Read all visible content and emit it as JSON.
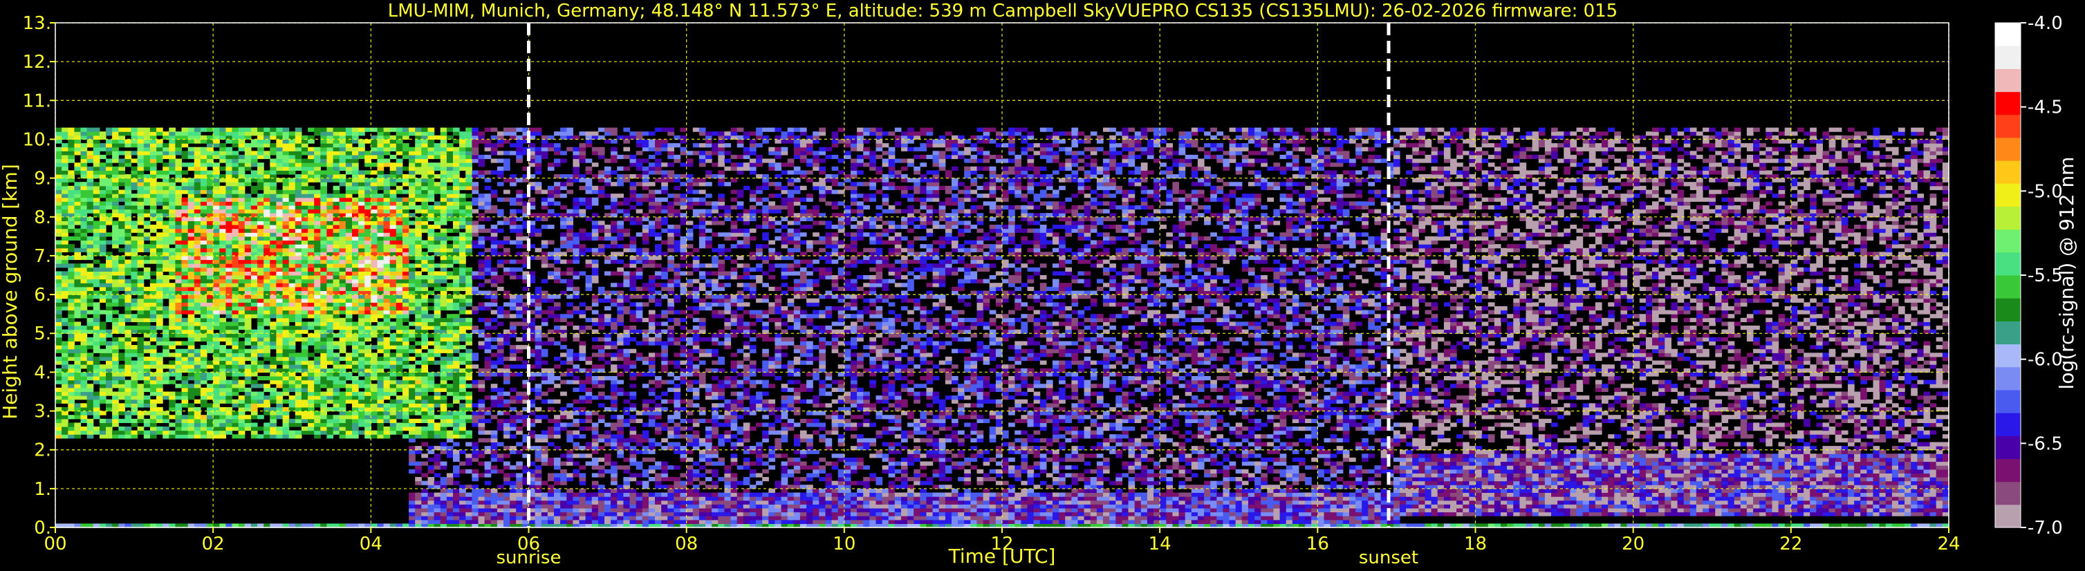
{
  "chart_data": {
    "type": "heatmap",
    "title": "LMU-MIM, Munich, Germany; 48.148° N 11.573° E, altitude: 539 m    Campbell SkyVUEPRO CS135 (CS135LMU): 26-02-2026    firmware: 015",
    "xlabel": "Time [UTC]",
    "ylabel": "Height above ground [km]",
    "xlim": [
      0,
      24
    ],
    "ylim": [
      0,
      13
    ],
    "x_ticks": [
      "00",
      "02",
      "04",
      "06",
      "08",
      "10",
      "12",
      "14",
      "16",
      "18",
      "20",
      "22",
      "24"
    ],
    "y_ticks": [
      "0.",
      "1.",
      "2.",
      "3.",
      "4.",
      "5.",
      "6.",
      "7.",
      "8.",
      "9.",
      "10.",
      "11.",
      "12.",
      "13."
    ],
    "grid": true,
    "grid_color": "#ffff00",
    "colorbar": {
      "label": "log(rc-signal) @ 912 nm",
      "range": [
        -7.0,
        -4.0
      ],
      "ticks": [
        "-4.0",
        "-4.5",
        "-5.0",
        "-5.5",
        "-6.0",
        "-6.5",
        "-7.0"
      ],
      "colors": [
        "#b8a0ae",
        "#8a4a7e",
        "#7a1070",
        "#4a00a8",
        "#2a18e8",
        "#4a5cf0",
        "#7a8cf4",
        "#a8b8f8",
        "#3aa088",
        "#1a8a1a",
        "#38c838",
        "#48e080",
        "#70f070",
        "#b8f038",
        "#f0f018",
        "#ffc818",
        "#ff8818",
        "#ff4018",
        "#ff0000",
        "#f0b8b8",
        "#f0f0f0",
        "#ffffff"
      ]
    },
    "events": [
      {
        "name": "sunrise",
        "time": 6.0
      },
      {
        "name": "sunset",
        "time": 16.9
      }
    ],
    "instrument_top_km": 10.3,
    "regions": [
      {
        "feature": "residual aerosol / noisy upper signal",
        "t_start": 0,
        "t_end": 5.3,
        "h_start": 2.3,
        "h_end": 10.3,
        "level": -5.4
      },
      {
        "feature": "elevated aerosol layer (night)",
        "t_start": 1.5,
        "t_end": 4.5,
        "h_start": 5.5,
        "h_end": 8.5,
        "level": -5.0
      },
      {
        "feature": "near-surface layer",
        "t_start": 0,
        "t_end": 24,
        "h_start": 0,
        "h_end": 0.15,
        "level": -5.8
      },
      {
        "feature": "boundary layer (day)",
        "t_start": 4.5,
        "t_end": 17.0,
        "h_start": 0,
        "h_end": 0.9,
        "level": -6.5
      },
      {
        "feature": "residual layer (evening)",
        "t_start": 17.0,
        "t_end": 24,
        "h_start": 0.3,
        "h_end": 1.9,
        "level": -6.6
      },
      {
        "feature": "daytime background noise",
        "t_start": 4.5,
        "t_end": 17.0,
        "h_start": 0.9,
        "h_end": 10.3,
        "level": -6.5
      },
      {
        "feature": "night background noise",
        "t_start": 17.0,
        "t_end": 24,
        "h_start": 1.9,
        "h_end": 10.3,
        "level": -6.8
      }
    ]
  }
}
